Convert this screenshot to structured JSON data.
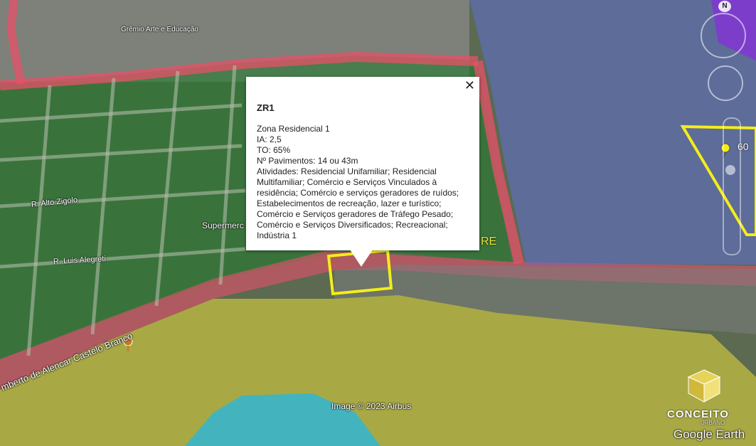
{
  "popup": {
    "title": "ZR1",
    "lines": [
      "Zona Residencial 1",
      "IA: 2,5",
      "TO: 65%",
      "Nº Pavimentos: 14 ou 43m",
      "Atividades: Residencial Unifamiliar; Residencial Multifamiliar; Comércio e Serviços Vinculados à residência; Comércio e serviços geradores de ruídos; Estabelecimentos de recreação, lazer e turístico; Comércio e Serviços geradores de Tráfego Pesado; Comércio e Serviços Diversificados; Recreacional; Indústria 1"
    ],
    "close_icon": "close-icon"
  },
  "streets": {
    "s1": "R. Alto Zigolo",
    "s2": "R. Luis Alegreti",
    "s3": "mberto de Alencar Castelo Branco"
  },
  "pois": {
    "top": "Grêmio Arte e Educação",
    "super": "Supermerc"
  },
  "zone_labels": {
    "re": "RE",
    "right": "60"
  },
  "credit": "Image © 2023 Airbus",
  "logo": "Google Earth",
  "brand": "CONCEITO",
  "brand_sub": "URBANO",
  "compass": "N",
  "colors": {
    "red_zone": "#e8506a",
    "green_zone": "#1e7a2a",
    "blue_zone": "#5f6ed6",
    "yellow_zone": "#e7dd3a",
    "cyan_zone": "#21b8e6",
    "purple_zone": "#8a2ae0",
    "outline_yellow": "#f4ee18"
  }
}
